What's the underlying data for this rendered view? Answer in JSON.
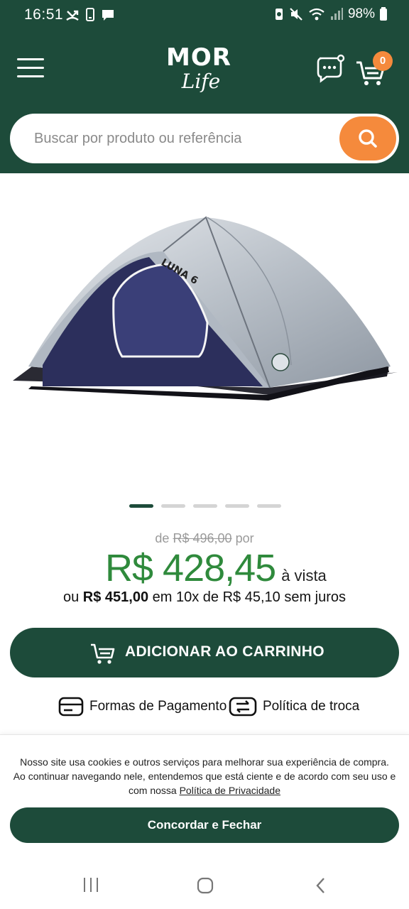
{
  "status": {
    "time": "16:51",
    "battery": "98%"
  },
  "header": {
    "logo_top": "MOR",
    "logo_bottom": "Life",
    "cart_count": "0"
  },
  "search": {
    "placeholder": "Buscar por produto ou referência"
  },
  "product": {
    "image_icon": "tent-image",
    "tent_label": "LUNA 6",
    "carousel_total": 5,
    "carousel_active": 1
  },
  "pricing": {
    "old_prefix": "de",
    "old_price": "R$ 496,00",
    "old_suffix": "por",
    "price": "R$ 428,45",
    "price_suffix": "à vista",
    "inst_prefix": "ou",
    "inst_total": "R$ 451,00",
    "inst_middle": "em 10x de R$ 45,10 sem juros"
  },
  "actions": {
    "add_to_cart": "ADICIONAR AO CARRINHO",
    "payment": "Formas de Pagamento",
    "exchange": "Política de troca"
  },
  "cookie": {
    "line1": "Nosso site usa cookies e outros serviços para melhorar sua experiência de compra.",
    "line2": "Ao continuar navegando nele, entendemos que está ciente e de acordo com seu uso e",
    "line3_prefix": "com nossa",
    "policy_link": "Política de Privacidade",
    "button": "Concordar e Fechar"
  },
  "colors": {
    "brand_green": "#1d4b3a",
    "accent_orange": "#f58a3c",
    "price_green": "#2f8a3c"
  }
}
